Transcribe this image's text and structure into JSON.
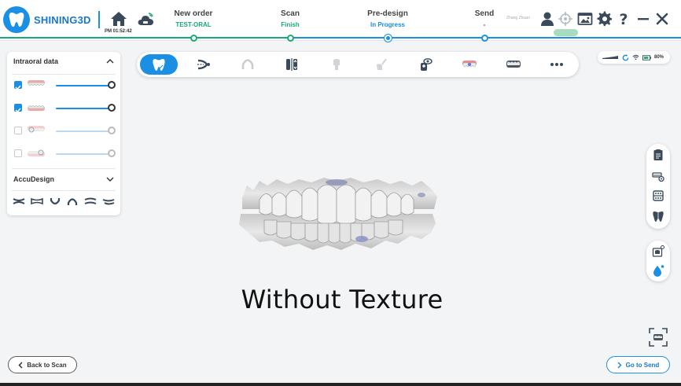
{
  "app": {
    "logo_text": "SHINING3D",
    "time": "PM 01:52:42",
    "user_name": "Zhang Zhuan"
  },
  "workflow": {
    "steps": [
      {
        "title": "New order",
        "status": "TEST-ORAL",
        "status_color": "#19a974"
      },
      {
        "title": "Scan",
        "status": "Finish",
        "status_color": "#19a974"
      },
      {
        "title": "Pre-design",
        "status": "In Progress",
        "status_color": "#1a8fe3"
      },
      {
        "title": "Send",
        "status": "-",
        "status_color": "#444444"
      }
    ]
  },
  "intraoral_panel": {
    "title": "Intraoral data",
    "items": [
      {
        "checked": true,
        "visibility": 1.0
      },
      {
        "checked": true,
        "visibility": 1.0
      },
      {
        "checked": false,
        "visibility": 1.0
      },
      {
        "checked": false,
        "visibility": 1.0
      }
    ]
  },
  "accudesign_panel": {
    "title": "AccuDesign"
  },
  "status": {
    "battery": "80%"
  },
  "caption": "Without Texture",
  "footer": {
    "back_label": "Back to Scan",
    "send_label": "Go to Send"
  },
  "colors": {
    "accent": "#1a8fe3",
    "success": "#19a974",
    "text": "#333333"
  }
}
